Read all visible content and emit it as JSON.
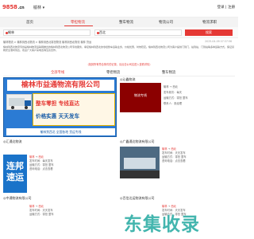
{
  "header": {
    "logo": "9858",
    "logo_suffix": ".cn",
    "city": "榆林 ▾",
    "login": "登录 | 注册"
  },
  "nav": [
    "首页",
    "零担物流",
    "整车物流",
    "物流公司",
    "物流求职"
  ],
  "search": {
    "from": "榆林",
    "to": "西北",
    "button": "搜索"
  },
  "breadcrumb": {
    "text": "榆林物流 > 榆林到西北物流 > 榆林到西北零担物流 榆林到西北物流 榆林 货运",
    "date": "2025-04-09 07:37:56"
  },
  "description": "榆林到西北物流专线是榆林物流运输网推出的榆林到西北物流公司专线服务，承接榆林到西北的零担整车运输业务，价格优惠，时效稳定。榆林到西北物流公司为客户提供门到门、站到站、门到站等多种运输方式，保证货物安全准时到达，欢迎广大客户来电咨询洽谈合作。",
  "notice": "（找到所有符合条件的记录，请点击公司名进入查看详情）",
  "tabs": [
    "全部专线",
    "零担物流",
    "整车物流"
  ],
  "main_ad": {
    "title": "榆林市益通物流有限公司",
    "line1": "整车零担 专线直达",
    "line2": "价格实惠 天天发车",
    "bottom": "榆林到西北 全国各地 货运专线"
  },
  "side_ad": {
    "head": "◎沁鑫物流",
    "img_label": "物流专线",
    "info": [
      "榆林 → 西北",
      "发车频次：每天",
      "运输方式：零担 整车",
      "联系人：张经理"
    ]
  },
  "cards": [
    {
      "head": "◎汇通达物流",
      "from": "榆林",
      "to": "西北",
      "meta": [
        "发车时间：每天发车",
        "运输方式：零担 整车",
        "咨询电话：点击查看"
      ]
    },
    {
      "head": "◎广鑫通达物流有限公司",
      "from": "榆林",
      "to": "西北",
      "meta": [
        "发车时间：天天发车",
        "运输方式：零担 整车",
        "咨询电话：点击查看"
      ]
    },
    {
      "head": "◎中通物流有限公司",
      "from": "榆林",
      "to": "西北",
      "meta": [
        "发车时间：天天发车",
        "运输方式：零担 整车"
      ]
    },
    {
      "head": "◎百信达运物流有限公司",
      "from": "榆林",
      "to": "西北",
      "meta": [
        "发车时间：天天发车",
        "运输方式：零担 整车"
      ]
    }
  ],
  "blue_badge": [
    "连邦",
    "速运"
  ],
  "watermark": "东集收录",
  "colors": {
    "accent": "#e53935",
    "brand_blue": "#2b7bd4"
  }
}
